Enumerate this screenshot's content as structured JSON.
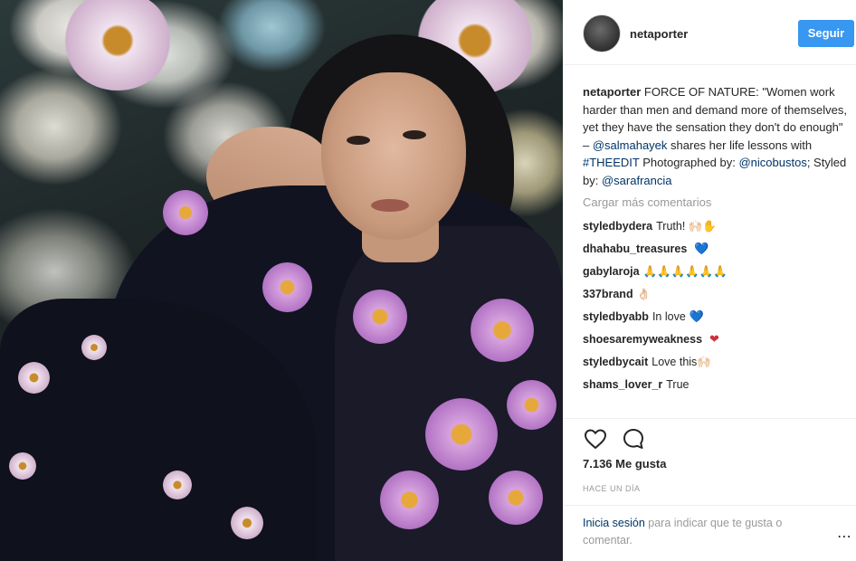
{
  "post": {
    "username": "netaporter",
    "follow_label": "Seguir",
    "caption": {
      "username": "netaporter",
      "text_1": " FORCE OF NATURE: \"Women work harder than men and demand more of themselves, yet they have the sensation they don't do enough\" – ",
      "mention_1": "@salmahayek",
      "text_2": " shares her life lessons with ",
      "hashtag": "#THEEDIT",
      "text_3": " Photographed by: ",
      "mention_2": "@nicobustos",
      "text_4": "; Styled by: ",
      "mention_3": "@sarafrancia"
    },
    "load_more": "Cargar más comentarios",
    "comments": [
      {
        "user": "styledbydera",
        "text": "Truth! 🙌🏻✋"
      },
      {
        "user": "dhahabu_treasures",
        "text": "",
        "heart": "💙"
      },
      {
        "user": "gabylaroja",
        "text": "🙏🙏🙏🙏🙏🙏"
      },
      {
        "user": "337brand",
        "text": "👌🏻"
      },
      {
        "user": "styledbyabb",
        "text": "In love",
        "heart": "💙"
      },
      {
        "user": "shoesaremyweakness",
        "text": "",
        "heart": "❤"
      },
      {
        "user": "styledbycait",
        "text": "Love this🙌🏻"
      },
      {
        "user": "shams_lover_r",
        "text": "True"
      }
    ],
    "likes": "7.136 Me gusta",
    "time": "HACE UN DÍA",
    "login_link": "Inicia sesión",
    "login_text": " para indicar que te gusta o comentar.",
    "more_icon": "⋯",
    "icons": {
      "like": "heart-outline-icon",
      "comment": "comment-bubble-icon",
      "more": "more-options-icon"
    },
    "colors": {
      "accent": "#3897f0",
      "link": "#003569",
      "muted": "#999999"
    }
  }
}
